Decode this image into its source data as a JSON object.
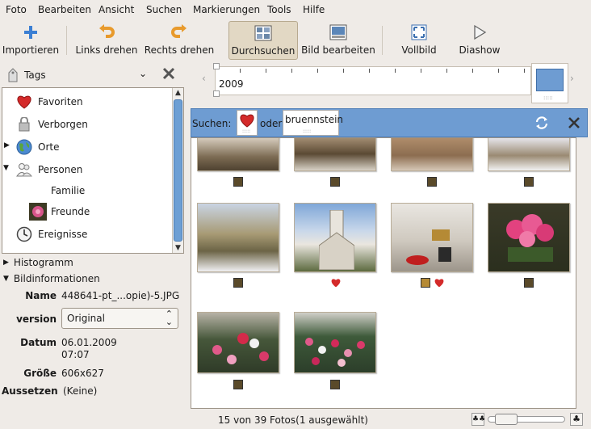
{
  "menu": {
    "items": [
      {
        "label": "Foto"
      },
      {
        "label": "Bearbeiten"
      },
      {
        "label": "Ansicht"
      },
      {
        "label": "Suchen"
      },
      {
        "label": "Markierungen"
      },
      {
        "label": "Tools"
      },
      {
        "label": "Hilfe"
      }
    ]
  },
  "toolbar": {
    "import_label": "Importieren",
    "rotate_left_label": "Links drehen",
    "rotate_right_label": "Rechts drehen",
    "browse_label": "Durchsuchen",
    "edit_label": "Bild bearbeiten",
    "fullscreen_label": "Vollbild",
    "slideshow_label": "Diashow"
  },
  "tags_panel": {
    "header": "Tags",
    "items": [
      {
        "label": "Favoriten",
        "icon": "heart-icon"
      },
      {
        "label": "Verborgen",
        "icon": "lock-icon"
      },
      {
        "label": "Orte",
        "icon": "globe-icon"
      },
      {
        "label": "Personen",
        "icon": "people-icon"
      },
      {
        "label": "Familie",
        "icon": ""
      },
      {
        "label": "Freunde",
        "icon": "flower-thumb-icon"
      },
      {
        "label": "Ereignisse",
        "icon": "clock-icon"
      }
    ]
  },
  "info": {
    "histogram_label": "Histogramm",
    "details_label": "Bildinformationen",
    "name_label": "Name",
    "name_value": "448641-pt_...opie)-5.JPG",
    "version_label": "version",
    "version_value": "Original",
    "date_label": "Datum",
    "date_value": "06.01.2009",
    "time_value": "07:07",
    "size_label": "Größe",
    "size_value": "606x627",
    "exposure_label": "Aussetzen",
    "exposure_value": "(Keine)"
  },
  "timeline": {
    "year": "2009"
  },
  "search": {
    "label": "Suchen:",
    "operator": "oder",
    "term": "bruennstein"
  },
  "status": {
    "text": "15 von 39 Fotos(1 ausgewählt)"
  },
  "colors": {
    "accent": "#6e9cd2",
    "heart": "#d42a2a"
  }
}
